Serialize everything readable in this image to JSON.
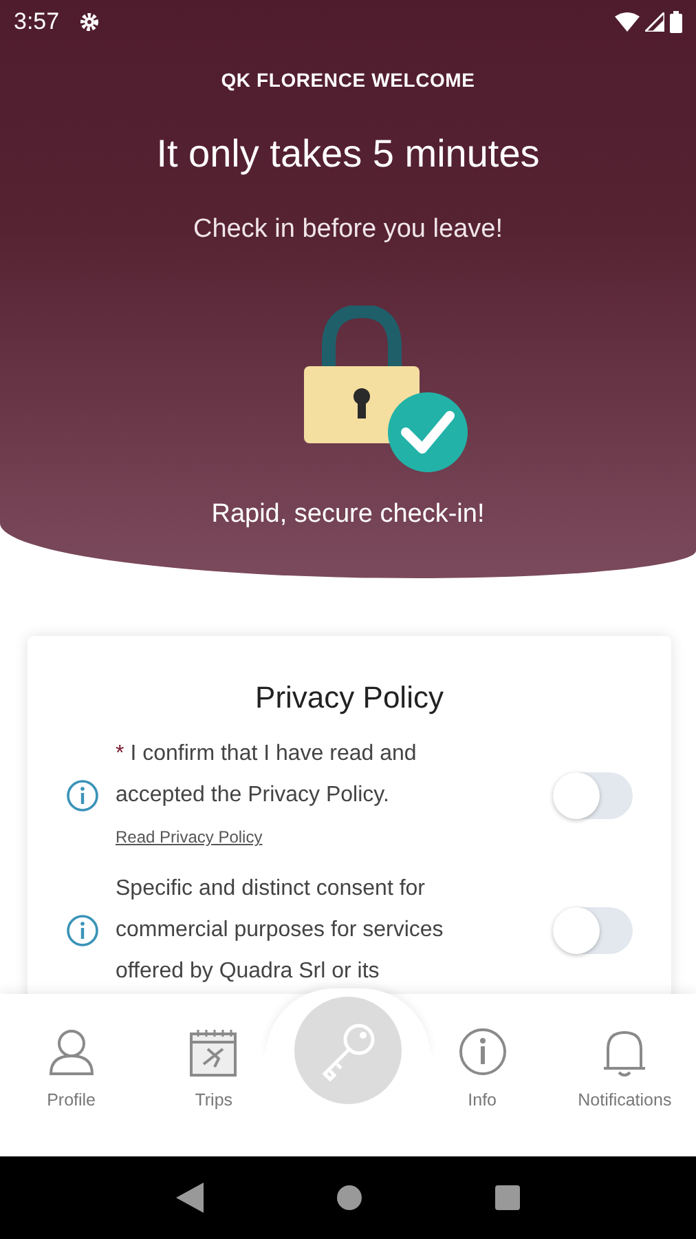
{
  "status_bar": {
    "time": "3:57"
  },
  "header": {
    "brand": "QK FLORENCE WELCOME",
    "title": "It only takes 5 minutes",
    "subtitle": "Check in before you leave!",
    "caption": "Rapid, secure check-in!"
  },
  "card": {
    "title": "Privacy Policy",
    "consents": [
      {
        "asterisk": "*",
        "text": "I confirm that I have read and accepted the Privacy Policy.",
        "link": "Read Privacy Policy",
        "on": false
      },
      {
        "text": "Specific and distinct consent for commercial purposes for services offered by Quadra Srl or its",
        "on": false
      }
    ]
  },
  "nav": {
    "items": [
      {
        "kind": "profile",
        "label": "Profile"
      },
      {
        "kind": "trips",
        "label": "Trips"
      },
      {
        "kind": "key"
      },
      {
        "kind": "info",
        "label": "Info"
      },
      {
        "kind": "notifications",
        "label": "Notifications"
      }
    ]
  }
}
